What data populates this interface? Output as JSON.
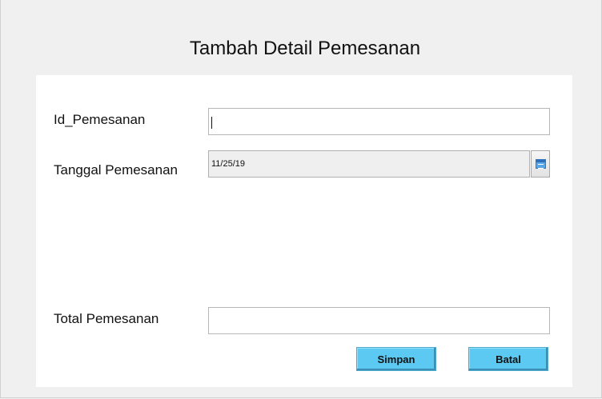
{
  "form": {
    "title": "Tambah Detail Pemesanan",
    "id_pemesanan": {
      "label": "Id_Pemesanan",
      "value": ""
    },
    "tanggal_pemesanan": {
      "label": "Tanggal Pemesanan",
      "value": "11/25/19",
      "picker_icon": "calendar-icon"
    },
    "total_pemesanan": {
      "label": "Total Pemesanan",
      "value": ""
    },
    "buttons": {
      "simpan": "Simpan",
      "batal": "Batal"
    },
    "colors": {
      "button_bg": "#5bc9f2",
      "panel_bg": "#ffffff",
      "window_bg": "#f0f0f0"
    }
  }
}
